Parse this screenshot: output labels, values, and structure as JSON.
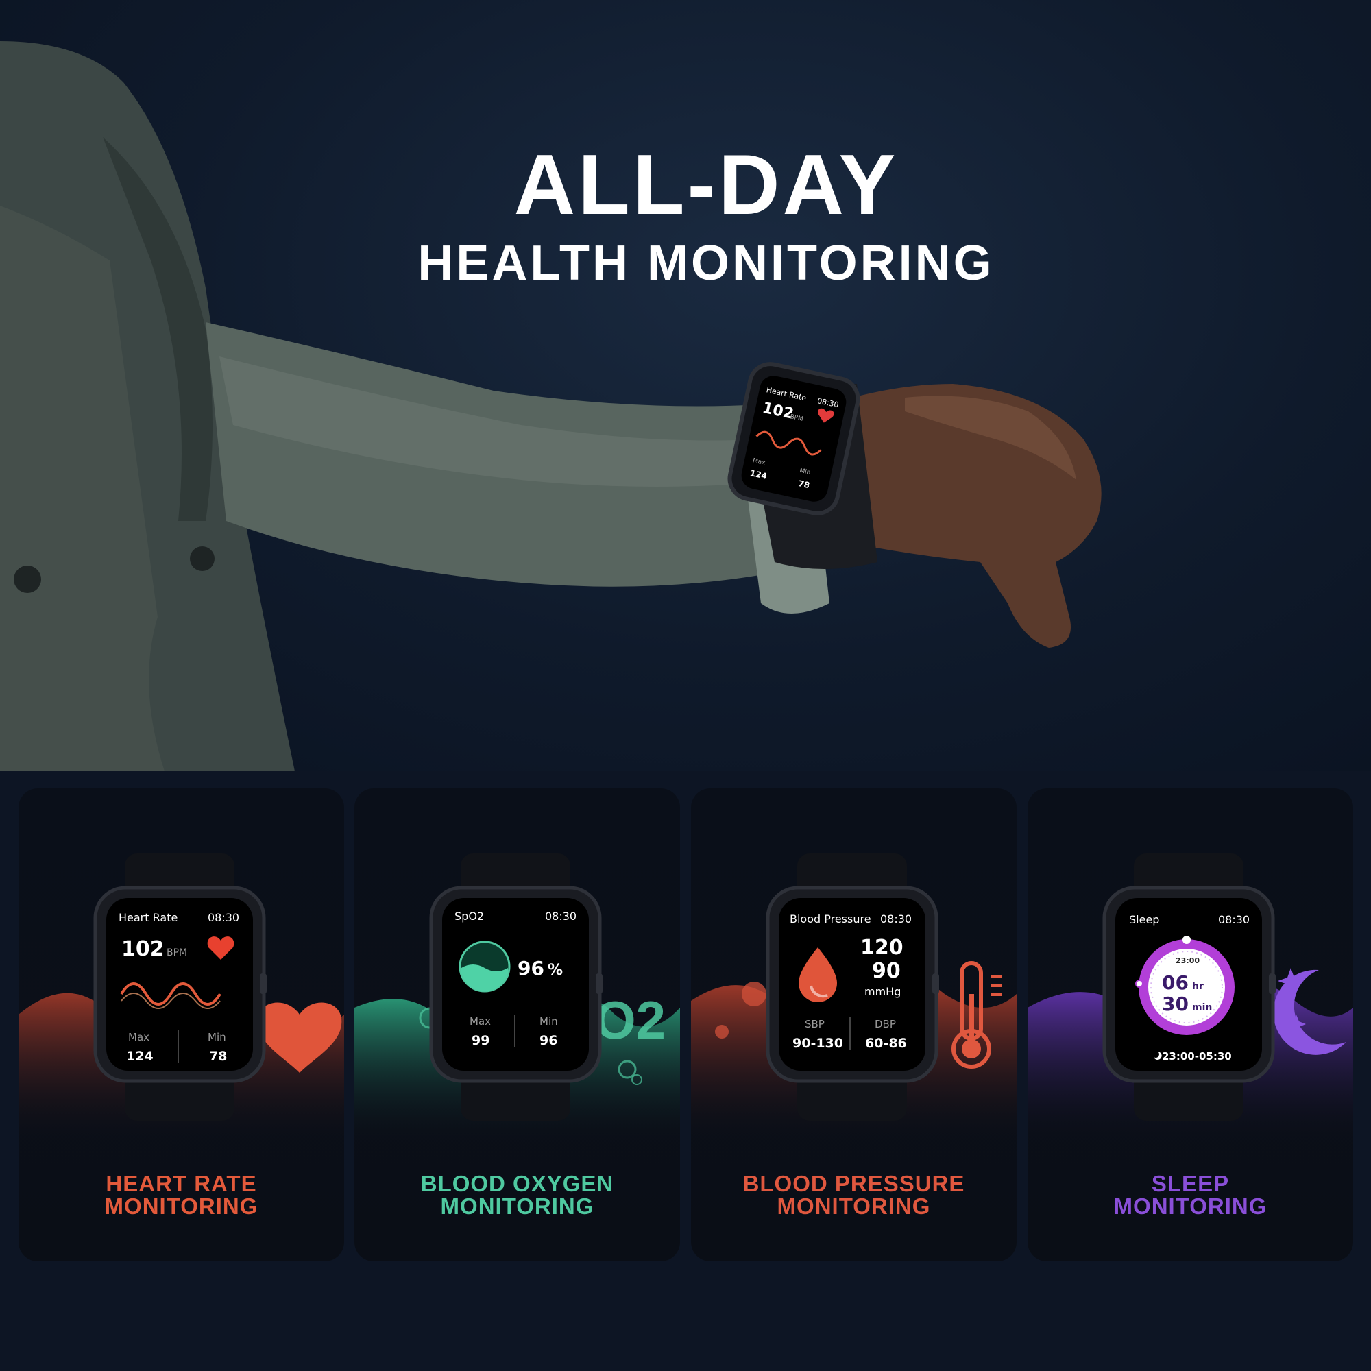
{
  "hero": {
    "title_line1": "ALL-DAY",
    "title_line2": "HEALTH MONITORING",
    "mini_watch": {
      "label": "Heart Rate",
      "time": "08:30",
      "value": "102",
      "unit": "BPM",
      "max_label": "Max",
      "min_label": "Min",
      "max": "124",
      "min": "78"
    }
  },
  "cards": [
    {
      "title_line1": "HEART RATE",
      "title_line2": "MONITORING",
      "accent": "#e35a3b",
      "screen": {
        "label": "Heart Rate",
        "time": "08:30",
        "value": "102",
        "unit": "BPM",
        "max_label": "Max",
        "min_label": "Min",
        "max": "124",
        "min": "78"
      }
    },
    {
      "title_line1": "BLOOD OXYGEN",
      "title_line2": "MONITORING",
      "accent": "#4fc9a0",
      "screen": {
        "label": "SpO2",
        "time": "08:30",
        "value": "96",
        "unit": "%",
        "max_label": "Max",
        "min_label": "Min",
        "max": "99",
        "min": "96",
        "icon_text": "O2"
      }
    },
    {
      "title_line1": "BLOOD PRESSURE",
      "title_line2": "MONITORING",
      "accent": "#e0583f",
      "screen": {
        "label": "Blood Pressure",
        "time": "08:30",
        "systolic": "120",
        "diastolic": "90",
        "unit": "mmHg",
        "sbp_label": "SBP",
        "dbp_label": "DBP",
        "sbp_range": "90-130",
        "dbp_range": "60-86"
      }
    },
    {
      "title_line1": "SLEEP",
      "title_line2": "MONITORING",
      "accent": "#8a4fd8",
      "screen": {
        "label": "Sleep",
        "time": "08:30",
        "hours": "06",
        "hours_unit": "hr",
        "minutes": "30",
        "minutes_unit": "min",
        "dial_time": "23:00",
        "range": "23:00-05:30"
      }
    }
  ]
}
